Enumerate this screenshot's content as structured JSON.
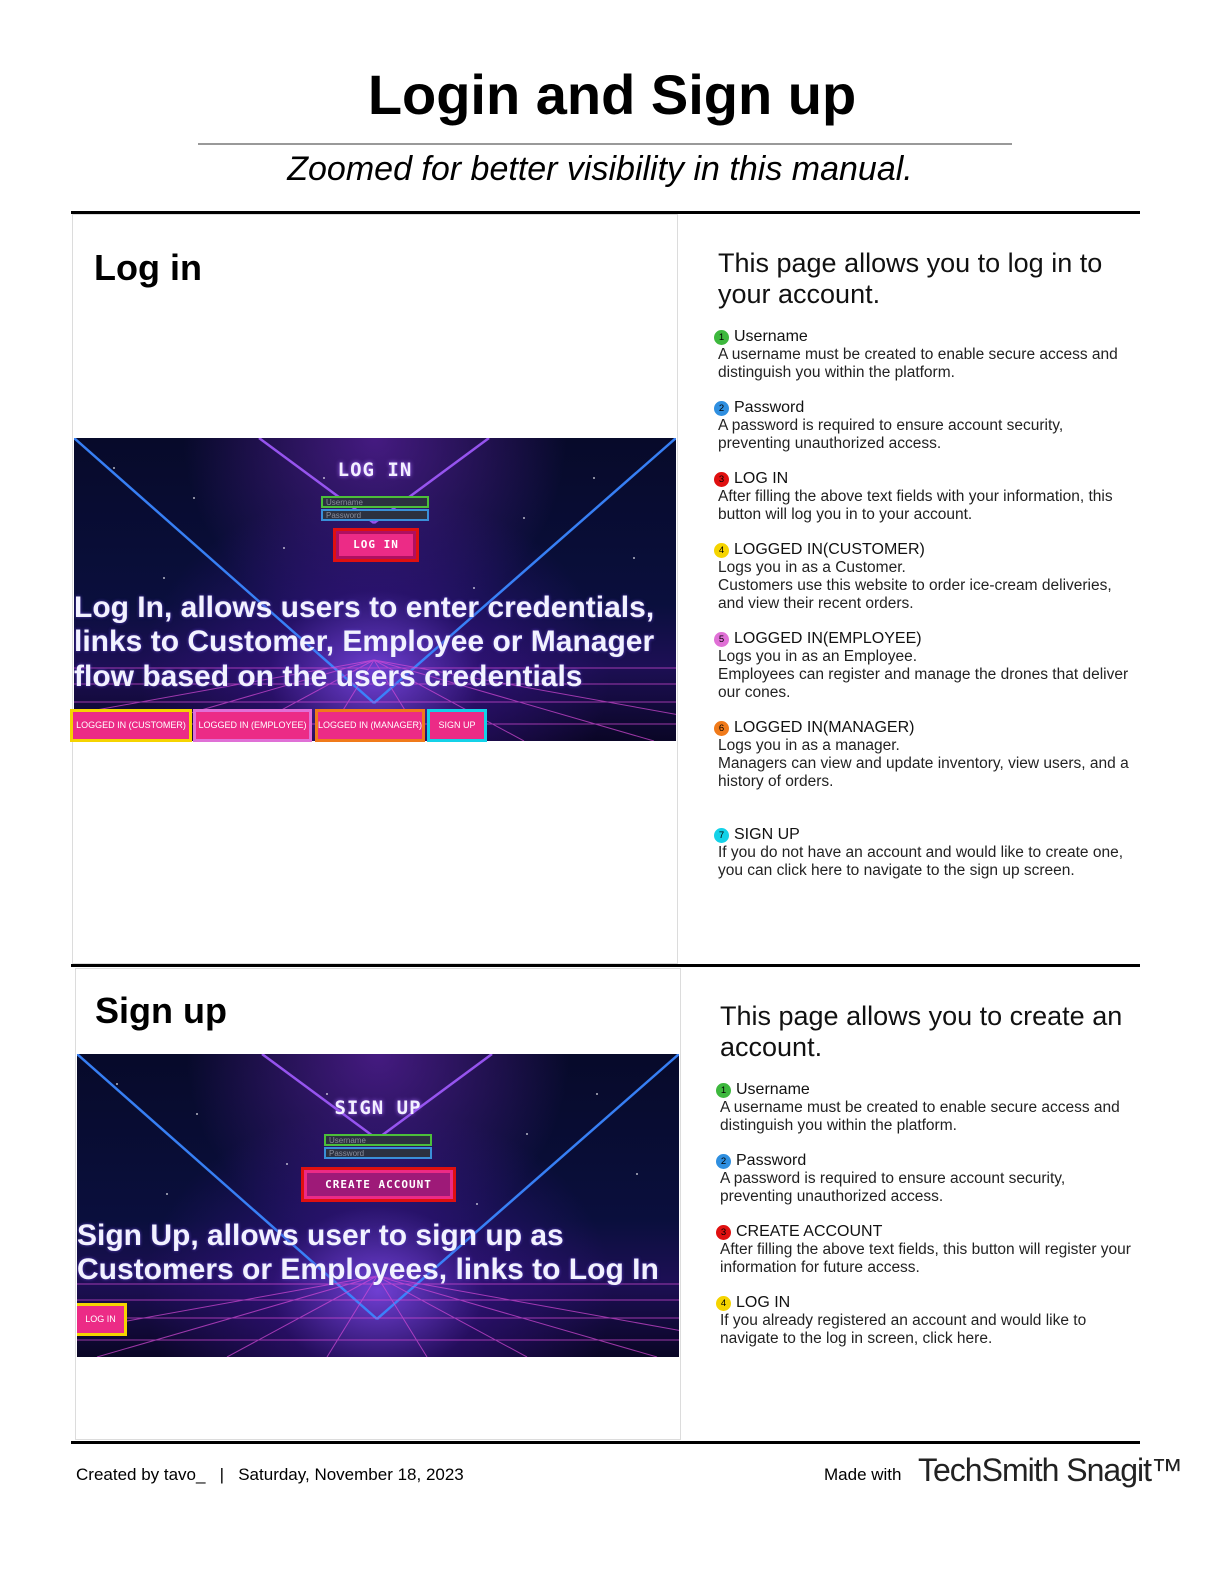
{
  "header": {
    "title": "Login and Sign up",
    "subtitle": "Zoomed for better visibility in this manual."
  },
  "login": {
    "heading": "Log in",
    "screenshot": {
      "title": "LOG IN",
      "username_placeholder": "Username",
      "password_placeholder": "Password",
      "login_button": "LOG IN",
      "overlay_lines": [
        "Log In, allows users to enter credentials,",
        "links to Customer, Employee or Manager",
        "flow based on the users credentials"
      ],
      "bottom_buttons": [
        "LOGGED IN (CUSTOMER)",
        "LOGGED IN (EMPLOYEE)",
        "LOGGED IN (MANAGER)",
        "SIGN UP"
      ]
    },
    "intro": "This page allows you to log in to your account.",
    "items": [
      {
        "num": "1",
        "title": "Username",
        "body": "A username must be created to enable secure access and\ndistinguish you within the platform."
      },
      {
        "num": "2",
        "title": "Password",
        "body": "A password is required to ensure account security,\npreventing unauthorized access."
      },
      {
        "num": "3",
        "title": "LOG IN",
        "body": "After filling the above text fields with your information, this\nbutton will log you in to your account."
      },
      {
        "num": "4",
        "title": "LOGGED IN(CUSTOMER)",
        "body": "Logs you in as a Customer.\nCustomers use this website to order ice-cream deliveries,\nand view their recent orders."
      },
      {
        "num": "5",
        "title": "LOGGED IN(EMPLOYEE)",
        "body": "Logs you in as an Employee.\nEmployees can register and manage the drones that deliver\nour cones."
      },
      {
        "num": "6",
        "title": "LOGGED IN(MANAGER)",
        "body": "Logs you in as a manager.\nManagers can view and update inventory, view users, and a\nhistory of orders."
      },
      {
        "num": "7",
        "title": "SIGN UP",
        "body": "If you do not have an account and would like to create one,\nyou can click here to navigate to the sign up screen."
      }
    ]
  },
  "signup": {
    "heading": "Sign up",
    "screenshot": {
      "title": "SIGN UP",
      "username_placeholder": "Username",
      "password_placeholder": "Password",
      "create_button": "CREATE ACCOUNT",
      "overlay_lines": [
        "Sign Up, allows user to sign up as",
        "Customers or Employees, links to Log In"
      ],
      "bottom_buttons": [
        "LOG IN"
      ]
    },
    "intro": "This page allows you to create an account.",
    "items": [
      {
        "num": "1",
        "title": "Username",
        "body": "A username must be created to enable secure access and\ndistinguish you within the platform."
      },
      {
        "num": "2",
        "title": "Password",
        "body": "A password is required to ensure account security,\npreventing unauthorized access."
      },
      {
        "num": "3",
        "title": "CREATE ACCOUNT",
        "body": "After filling the above text fields, this button will register your\ninformation for future access."
      },
      {
        "num": "4",
        "title": "LOG IN",
        "body": "If you already registered an account and would like to\nnavigate to the log in screen, click here."
      }
    ]
  },
  "footer": {
    "created": "Created by tavo_   |   Saturday, November 18, 2023",
    "made_with": "Made with",
    "brand": "TechSmith Snagit™"
  },
  "colors": {
    "green": "#3db83d",
    "blue": "#2f8fe0",
    "red": "#e01010",
    "yellow": "#f5d400",
    "pink": "#e070d6",
    "orange": "#f07a1a",
    "cyan": "#14d2e8",
    "button_pink": "#ec2b86"
  }
}
